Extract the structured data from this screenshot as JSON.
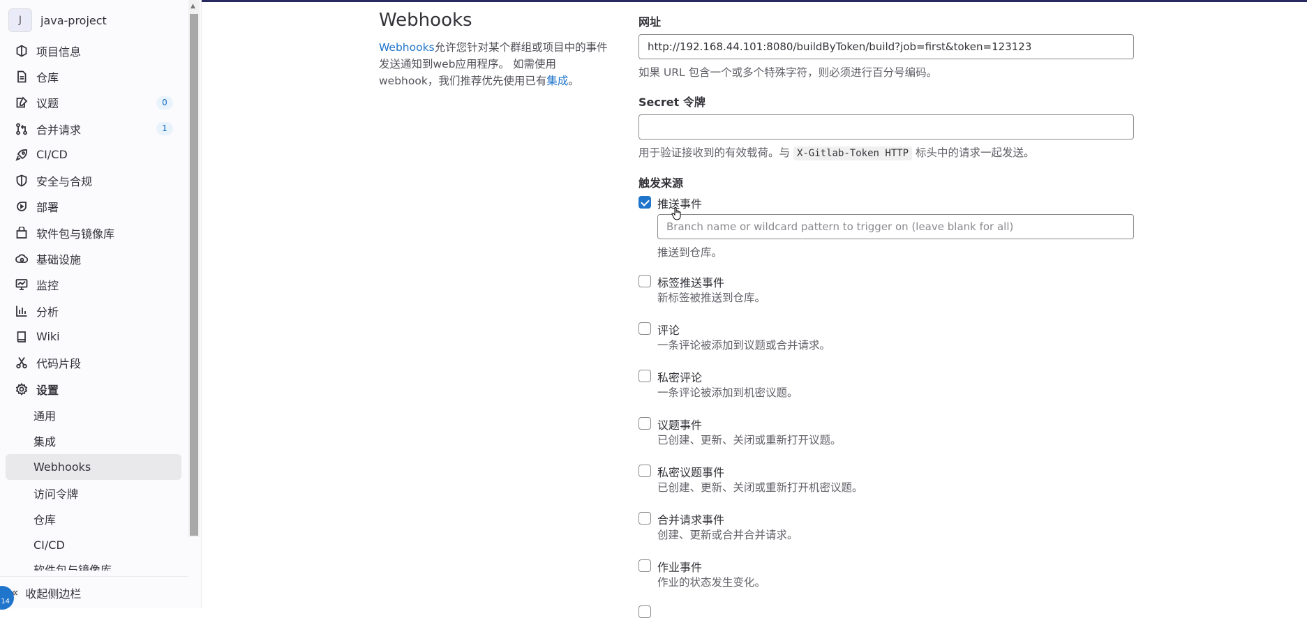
{
  "project": {
    "avatar_letter": "J",
    "name": "java-project"
  },
  "sidebar": {
    "items": [
      {
        "label": "项目信息",
        "icon": "project-icon"
      },
      {
        "label": "仓库",
        "icon": "document-icon"
      },
      {
        "label": "议题",
        "icon": "issues-icon",
        "badge": "0"
      },
      {
        "label": "合并请求",
        "icon": "merge-request-icon",
        "badge": "1"
      },
      {
        "label": "CI/CD",
        "icon": "rocket-icon"
      },
      {
        "label": "安全与合规",
        "icon": "shield-icon"
      },
      {
        "label": "部署",
        "icon": "deployments-icon"
      },
      {
        "label": "软件包与镜像库",
        "icon": "package-icon"
      },
      {
        "label": "基础设施",
        "icon": "cloud-gear-icon"
      },
      {
        "label": "监控",
        "icon": "monitor-icon"
      },
      {
        "label": "分析",
        "icon": "chart-icon"
      },
      {
        "label": "Wiki",
        "icon": "book-icon"
      },
      {
        "label": "代码片段",
        "icon": "scissors-icon"
      },
      {
        "label": "设置",
        "icon": "settings-icon"
      }
    ],
    "settings_sub": [
      "通用",
      "集成",
      "Webhooks",
      "访问令牌",
      "仓库",
      "CI/CD",
      "软件包与镜像库"
    ],
    "collapse_label": "收起侧边栏",
    "help_badge": "14"
  },
  "main": {
    "title": "Webhooks",
    "desc_link1": "Webhooks",
    "desc_text1": "允许您针对某个群组或项目中的事件发送通知到web应用程序。 如需使用webhook，我们推荐优先使用已有",
    "desc_link2": "集成",
    "desc_text2": "。"
  },
  "form": {
    "url_label": "网址",
    "url_value": "http://192.168.44.101:8080/buildByToken/build?job=first&token=123123",
    "url_help": "如果 URL 包含一个或多个特殊字符，则必须进行百分号编码。",
    "secret_label": "Secret 令牌",
    "secret_value": "",
    "secret_help_pre": "用于验证接收到的有效载荷。与",
    "secret_help_code": "X-Gitlab-Token HTTP",
    "secret_help_post": "标头中的请求一起发送。",
    "trigger_label": "触发来源",
    "push_title": "推送事件",
    "push_placeholder": "Branch name or wildcard pattern to trigger on (leave blank for all)",
    "push_help": "推送到仓库。",
    "events": [
      {
        "title": "标签推送事件",
        "help": "新标签被推送到仓库。",
        "checked": false
      },
      {
        "title": "评论",
        "help": "一条评论被添加到议题或合并请求。",
        "checked": false
      },
      {
        "title": "私密评论",
        "help": "一条评论被添加到机密议题。",
        "checked": false
      },
      {
        "title": "议题事件",
        "help": "已创建、更新、关闭或重新打开议题。",
        "checked": false
      },
      {
        "title": "私密议题事件",
        "help": "已创建、更新、关闭或重新打开机密议题。",
        "checked": false
      },
      {
        "title": "合并请求事件",
        "help": "创建、更新或合并合并请求。",
        "checked": false
      },
      {
        "title": "作业事件",
        "help": "作业的状态发生变化。",
        "checked": false
      }
    ]
  }
}
